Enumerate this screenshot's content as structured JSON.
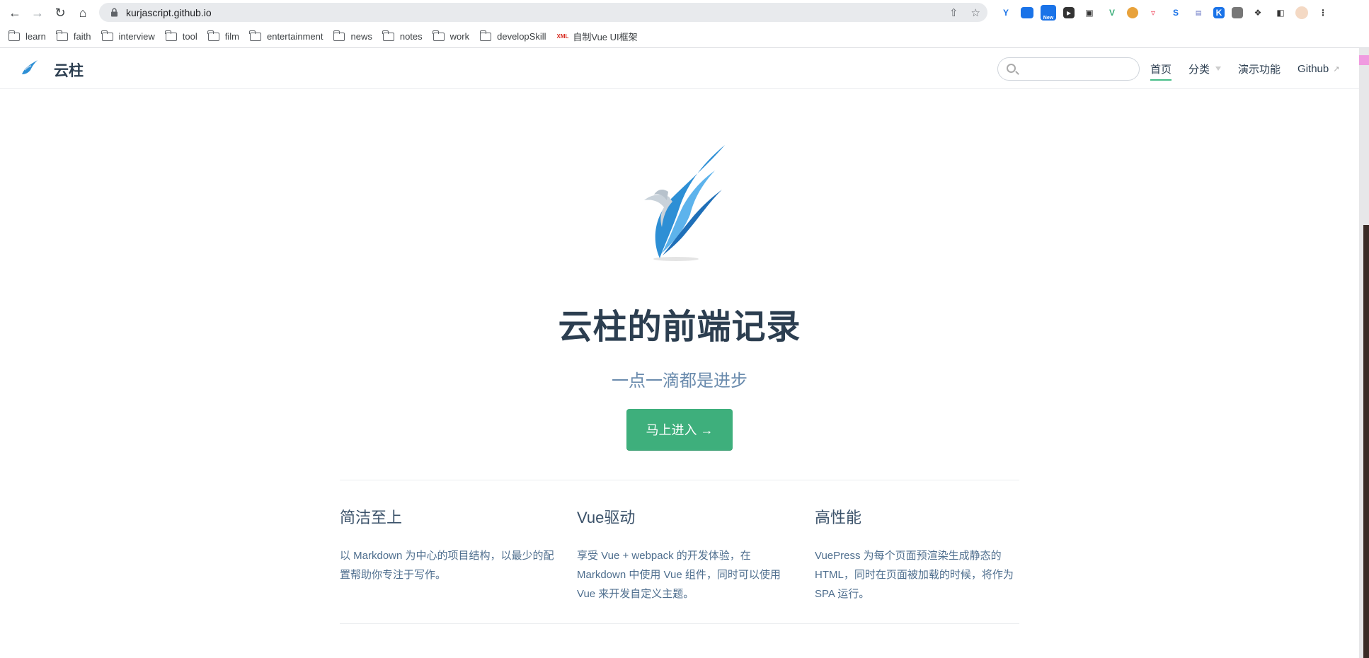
{
  "browser": {
    "url": "kurjascript.github.io",
    "bookmarks": [
      "learn",
      "faith",
      "interview",
      "tool",
      "film",
      "entertainment",
      "news",
      "notes",
      "work",
      "developSkill"
    ],
    "bookmark_special": "自制Vue UI框架",
    "extension_new_badge": "New"
  },
  "site": {
    "title": "云柱",
    "search_placeholder": "",
    "nav": {
      "home": "首页",
      "category": "分类",
      "demo": "演示功能",
      "github": "Github"
    }
  },
  "hero": {
    "title": "云柱的前端记录",
    "description": "一点一滴都是进步",
    "action": "马上进入 →"
  },
  "features": [
    {
      "title": "简洁至上",
      "details": "以 Markdown 为中心的项目结构，以最少的配置帮助你专注于写作。"
    },
    {
      "title": "Vue驱动",
      "details": "享受 Vue + webpack 的开发体验，在 Markdown 中使用 Vue 组件，同时可以使用 Vue 来开发自定义主题。"
    },
    {
      "title": "高性能",
      "details": "VuePress 为每个页面预渲染生成静态的 HTML，同时在页面被加载的时候，将作为 SPA 运行。"
    }
  ],
  "colors": {
    "accent": "#3eaf7c",
    "logo_blue": "#2d8fd5"
  }
}
